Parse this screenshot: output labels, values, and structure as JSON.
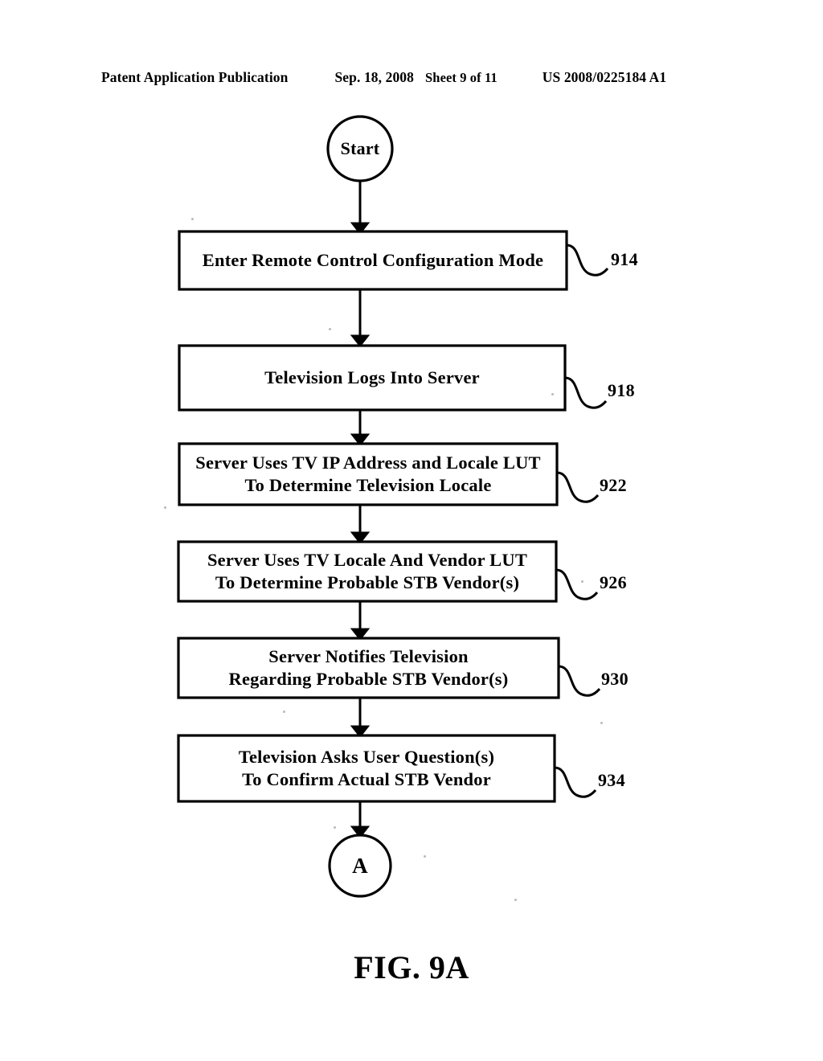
{
  "header": {
    "publication": "Patent Application Publication",
    "date": "Sep. 18, 2008",
    "sheet": "Sheet 9 of 11",
    "document_number": "US 2008/0225184 A1"
  },
  "figure": {
    "caption": "FIG. 9A",
    "ink_color": "#000000",
    "background_color": "#ffffff",
    "start_node": {
      "label": "Start",
      "shape": "circle"
    },
    "end_connector": {
      "label": "A",
      "shape": "circle"
    },
    "steps": [
      {
        "lines": [
          "Enter Remote Control Configuration Mode"
        ],
        "ref": "914"
      },
      {
        "lines": [
          "Television Logs Into Server"
        ],
        "ref": "918"
      },
      {
        "lines": [
          "Server Uses TV IP Address and Locale LUT",
          "To Determine Television Locale"
        ],
        "ref": "922"
      },
      {
        "lines": [
          "Server Uses TV Locale And Vendor LUT",
          "To Determine Probable STB Vendor(s)"
        ],
        "ref": "926"
      },
      {
        "lines": [
          "Server Notifies Television",
          "Regarding Probable STB Vendor(s)"
        ],
        "ref": "930"
      },
      {
        "lines": [
          "Television Asks User Question(s)",
          "To Confirm Actual STB Vendor"
        ],
        "ref": "934"
      }
    ]
  }
}
